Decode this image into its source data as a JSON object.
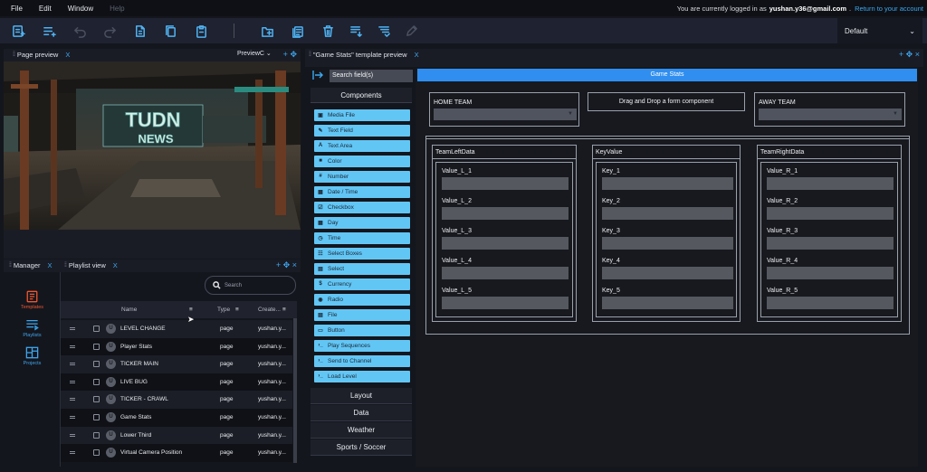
{
  "menu": [
    "File",
    "Edit",
    "Window",
    "Help"
  ],
  "login": {
    "prefix": "You are currently logged in as",
    "email": "yushan.y36@gmail.com",
    "suffix": ".",
    "link": "Return to your account"
  },
  "profile": {
    "value": "Default"
  },
  "panels": {
    "page_preview": {
      "title": "Page preview",
      "close": "X",
      "selector": "PreviewC"
    },
    "manager": {
      "title": "Manager",
      "close": "X"
    },
    "playlist": {
      "title": "Playlist view",
      "close": "X"
    },
    "template": {
      "title": "\"Game Stats\" template preview",
      "close": "X"
    }
  },
  "preview_text": {
    "line1": "TUDN",
    "line2": "NEWS"
  },
  "sidebar": [
    {
      "label": "Templates",
      "icon": "templates-icon",
      "active": true
    },
    {
      "label": "Playlists",
      "icon": "playlists-icon"
    },
    {
      "label": "Projects",
      "icon": "projects-icon"
    }
  ],
  "playlist": {
    "search_placeholder": "Search",
    "columns": [
      "Name",
      "Type",
      "Create..."
    ],
    "rows": [
      {
        "name": "LEVEL CHANGE",
        "type": "page",
        "creator": "yushan.y..."
      },
      {
        "name": "Player Stats",
        "type": "page",
        "creator": "yushan.y..."
      },
      {
        "name": "TICKER MAIN",
        "type": "page",
        "creator": "yushan.y..."
      },
      {
        "name": "LIVE BUG",
        "type": "page",
        "creator": "yushan.y..."
      },
      {
        "name": "TICKER - CRAWL",
        "type": "page",
        "creator": "yushan.y..."
      },
      {
        "name": "Game Stats",
        "type": "page",
        "creator": "yushan.y..."
      },
      {
        "name": "Lower Third",
        "type": "page",
        "creator": "yushan.y..."
      },
      {
        "name": "Virtual Camera Position",
        "type": "page",
        "creator": "yushan.y..."
      }
    ]
  },
  "components": {
    "search": "Search field(s)",
    "header": "Components",
    "items": [
      {
        "label": "Media File",
        "icon": "image-icon",
        "glyph": "▣"
      },
      {
        "label": "Text Field",
        "icon": "text-field-icon",
        "glyph": "✎"
      },
      {
        "label": "Text Area",
        "icon": "text-area-icon",
        "glyph": "A"
      },
      {
        "label": "Color",
        "icon": "color-icon",
        "glyph": "■"
      },
      {
        "label": "Number",
        "icon": "number-icon",
        "glyph": "#"
      },
      {
        "label": "Date / Time",
        "icon": "calendar-icon",
        "glyph": "▦"
      },
      {
        "label": "Checkbox",
        "icon": "checkbox-icon",
        "glyph": "☑"
      },
      {
        "label": "Day",
        "icon": "day-icon",
        "glyph": "▦"
      },
      {
        "label": "Time",
        "icon": "clock-icon",
        "glyph": "◷"
      },
      {
        "label": "Select Boxes",
        "icon": "select-boxes-icon",
        "glyph": "☷"
      },
      {
        "label": "Select",
        "icon": "select-icon",
        "glyph": "▤"
      },
      {
        "label": "Currency",
        "icon": "currency-icon",
        "glyph": "$"
      },
      {
        "label": "Radio",
        "icon": "radio-icon",
        "glyph": "◉"
      },
      {
        "label": "File",
        "icon": "file-icon",
        "glyph": "▤"
      },
      {
        "label": "Button",
        "icon": "button-icon",
        "glyph": "▭"
      },
      {
        "label": "Play Sequences",
        "icon": "terminal-icon",
        "glyph": "›_"
      },
      {
        "label": "Send to Channel",
        "icon": "terminal-icon",
        "glyph": "›_"
      },
      {
        "label": "Load Level",
        "icon": "terminal-icon",
        "glyph": "›_"
      }
    ],
    "categories": [
      "Layout",
      "Data",
      "Weather",
      "Sports / Soccer"
    ]
  },
  "form": {
    "title": "Game Stats",
    "home": "HOME TEAM",
    "dropzone": "Drag and Drop a form component",
    "away": "AWAY TEAM",
    "columns": [
      {
        "title": "TeamLeftData",
        "fields": [
          "Value_L_1",
          "Value_L_2",
          "Value_L_3",
          "Value_L_4",
          "Value_L_5"
        ]
      },
      {
        "title": "KeyValue",
        "fields": [
          "Key_1",
          "Key_2",
          "Key_3",
          "Key_4",
          "Key_5"
        ]
      },
      {
        "title": "TeamRightData",
        "fields": [
          "Value_R_1",
          "Value_R_2",
          "Value_R_3",
          "Value_R_4",
          "Value_R_5"
        ]
      }
    ]
  }
}
